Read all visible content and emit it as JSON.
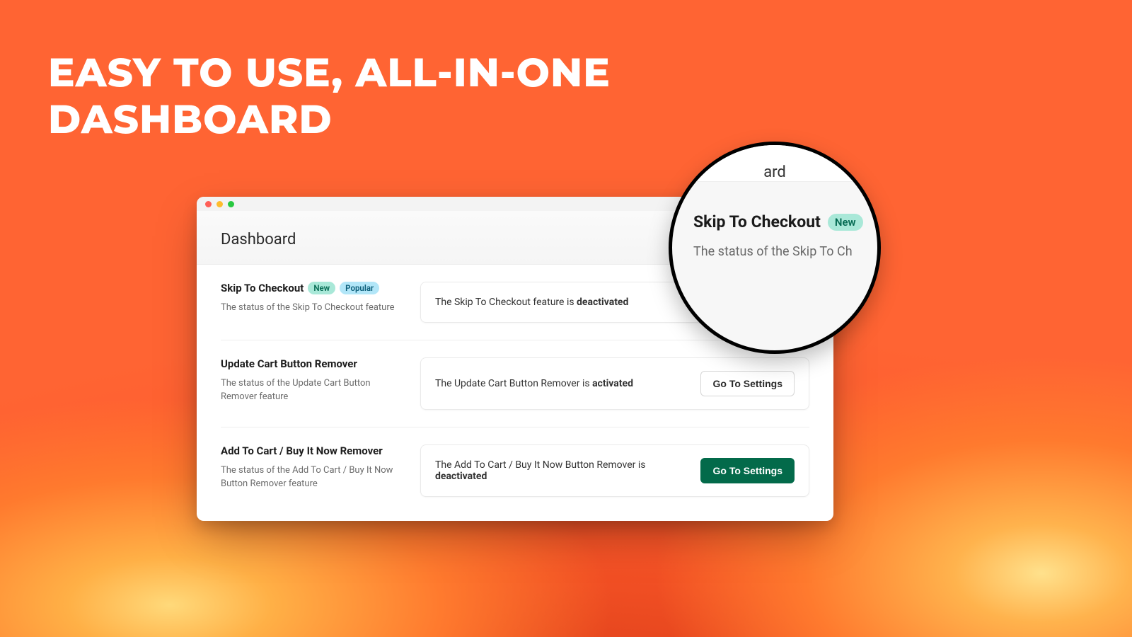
{
  "headline_l1": "EASY TO USE, ALL-IN-ONE",
  "headline_l2": "DASHBOARD",
  "page_title": "Dashboard",
  "badges": {
    "new": "New",
    "popular": "Popular"
  },
  "buttons": {
    "go_to_settings": "Go To Settings"
  },
  "features": [
    {
      "title": "Skip To Checkout",
      "badges": [
        "new",
        "popular"
      ],
      "desc": "The status of the Skip To Checkout feature",
      "status_prefix": "The Skip To Checkout feature is ",
      "status_word": "deactivated",
      "show_button": false,
      "button_style": ""
    },
    {
      "title": "Update Cart Button Remover",
      "badges": [],
      "desc": "The status of the Update Cart Button Remover feature",
      "status_prefix": "The Update Cart Button Remover is ",
      "status_word": "activated",
      "show_button": true,
      "button_style": "default"
    },
    {
      "title": "Add To Cart / Buy It Now Remover",
      "badges": [],
      "desc": "The status of the Add To Cart / Buy It Now Button Remover feature",
      "status_prefix": "The Add To Cart / Buy It Now Button Remover is ",
      "status_word": "deactivated",
      "show_button": true,
      "button_style": "primary"
    }
  ],
  "lens": {
    "peek_text": "ard",
    "title": "Skip To Checkout",
    "badge": "New",
    "desc": "The status of the Skip To Ch"
  }
}
